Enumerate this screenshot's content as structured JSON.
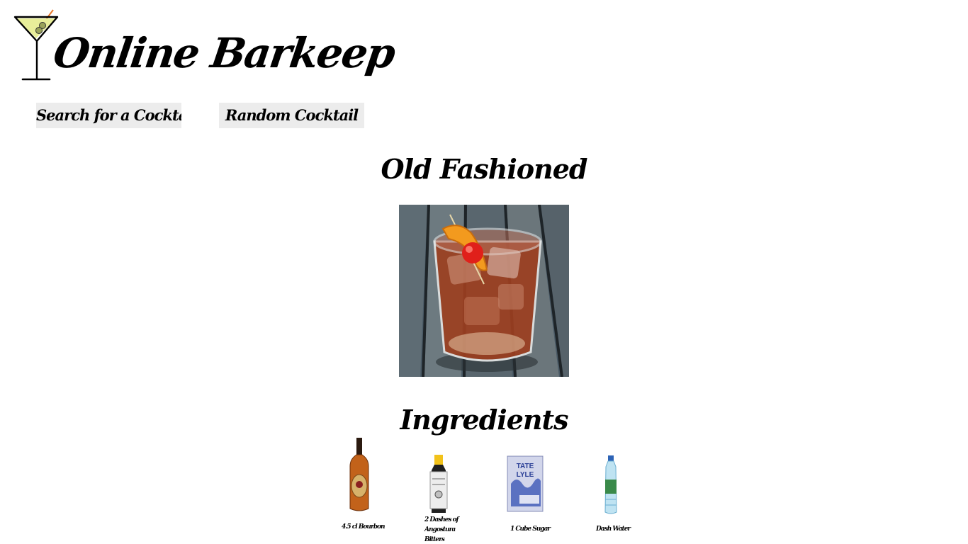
{
  "header": {
    "app_title": "Online Barkeep",
    "logo_icon": "martini-glass-icon"
  },
  "nav": {
    "search_label": "Search for a Cocktail",
    "random_label": "Random Cocktail"
  },
  "drink": {
    "name": "Old Fashioned",
    "photo_icon": "old-fashioned-cocktail-photo"
  },
  "ingredients": {
    "heading": "Ingredients",
    "items": [
      {
        "label": "4.5 cl Bourbon",
        "icon": "bourbon-bottle-icon"
      },
      {
        "label": "2 Dashes of Angostura Bitters",
        "icon": "bitters-bottle-icon"
      },
      {
        "label": "1 Cube Sugar",
        "icon": "sugar-box-icon"
      },
      {
        "label": "Dash Water",
        "icon": "water-bottle-icon"
      }
    ]
  },
  "colors": {
    "button_bg": "#ececec",
    "text": "#000000",
    "background": "#ffffff",
    "glass_liquid": "#e8ee9a"
  }
}
